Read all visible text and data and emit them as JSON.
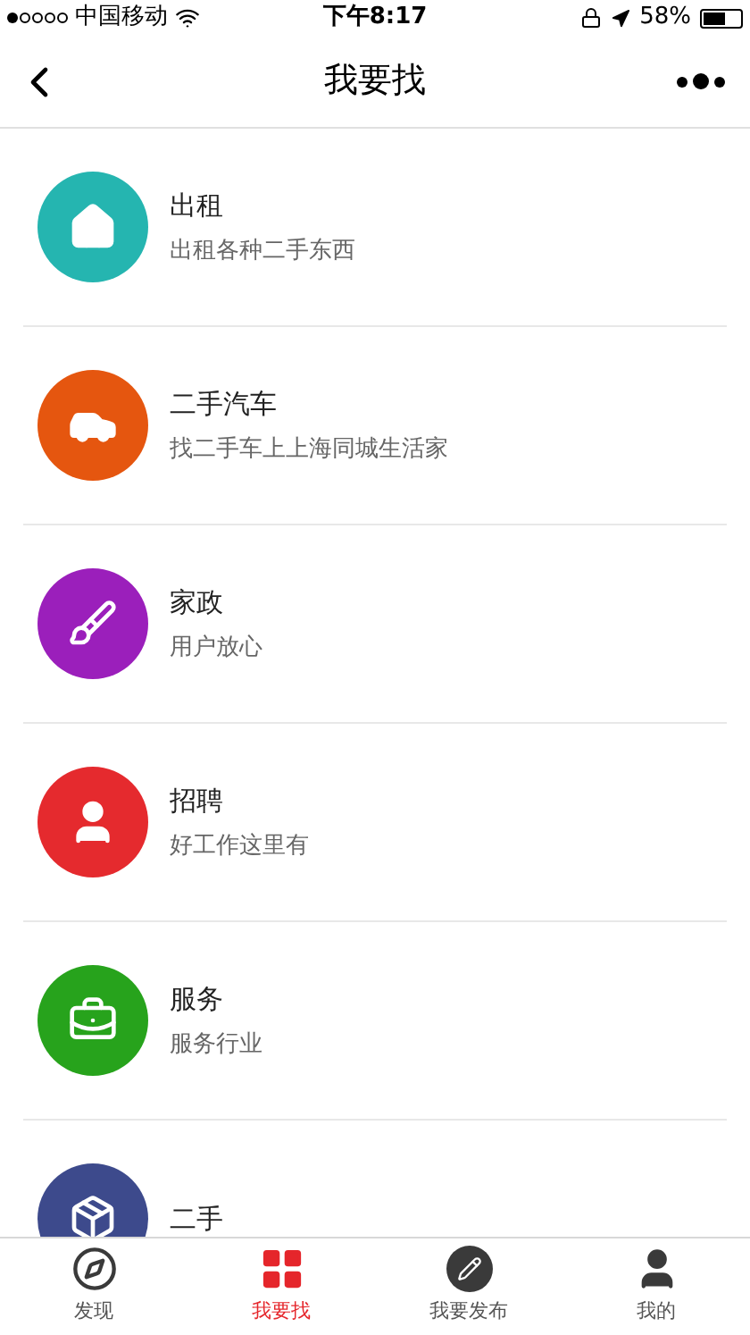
{
  "status_bar": {
    "carrier": "中国移动",
    "time": "下午8:17",
    "battery": "58%"
  },
  "nav": {
    "title": "我要找"
  },
  "items": [
    {
      "kind": "house",
      "color": "#25b5b0",
      "title": "出租",
      "subtitle": "出租各种二手东西"
    },
    {
      "kind": "car",
      "color": "#e5560f",
      "title": "二手汽车",
      "subtitle": "找二手车上上海同城生活家"
    },
    {
      "kind": "housework",
      "color": "#9b1fbb",
      "title": "家政",
      "subtitle": "用户放心"
    },
    {
      "kind": "person",
      "color": "#e52a2e",
      "title": "招聘",
      "subtitle": "好工作这里有"
    },
    {
      "kind": "toolbox",
      "color": "#27a31c",
      "title": "服务",
      "subtitle": "服务行业"
    },
    {
      "kind": "box",
      "color": "#3d4a8c",
      "title": "二手"
    }
  ],
  "tab_bar": [
    {
      "kind": "discover",
      "label": "发现",
      "selected": false
    },
    {
      "kind": "find",
      "label": "我要找",
      "selected": true
    },
    {
      "kind": "publish",
      "label": "我要发布",
      "selected": false
    },
    {
      "kind": "me",
      "label": "我的",
      "selected": false
    }
  ]
}
